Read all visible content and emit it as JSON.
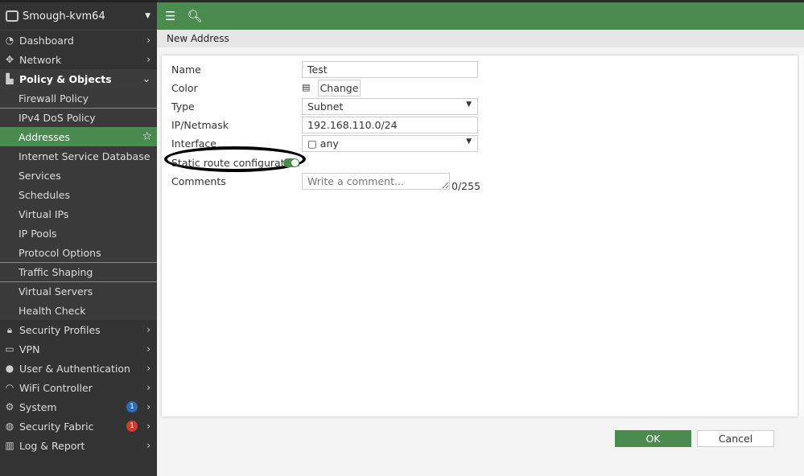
{
  "sidebar": {
    "device": "Smough-kvm64",
    "items": [
      {
        "label": "Dashboard",
        "icon": "dashboard-icon"
      },
      {
        "label": "Network",
        "icon": "network-icon"
      },
      {
        "label": "Policy & Objects",
        "icon": "policy-icon"
      }
    ],
    "sub": [
      "Firewall Policy",
      "IPv4 DoS Policy",
      "Addresses",
      "Internet Service Database",
      "Services",
      "Schedules",
      "Virtual IPs",
      "IP Pools",
      "Protocol Options",
      "Traffic Shaping",
      "Virtual Servers",
      "Health Check"
    ],
    "bottom": [
      {
        "label": "Security Profiles"
      },
      {
        "label": "VPN"
      },
      {
        "label": "User & Authentication"
      },
      {
        "label": "WiFi Controller"
      },
      {
        "label": "System",
        "badge": "1"
      },
      {
        "label": "Security Fabric",
        "badge": "1"
      },
      {
        "label": "Log & Report"
      }
    ]
  },
  "breadcrumb": "New Address",
  "form": {
    "name_label": "Name",
    "name": "Test",
    "color_label": "Color",
    "change": "Change",
    "type_label": "Type",
    "type": "Subnet",
    "ip_label": "IP/Netmask",
    "ip": "192.168.110.0/24",
    "iface_label": "Interface",
    "iface": "any",
    "static_label": "Static route configuration",
    "comments_label": "Comments",
    "comments_placeholder": "Write a comment...",
    "counter": "0/255"
  },
  "buttons": {
    "ok": "OK",
    "cancel": "Cancel"
  },
  "colors": {
    "accent": "#4b8b4f",
    "sidebar": "#333333"
  }
}
